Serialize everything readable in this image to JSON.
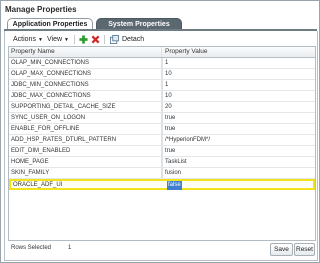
{
  "window": {
    "title": "Manage Properties"
  },
  "tabs": [
    {
      "label": "Application Properties",
      "active": true
    },
    {
      "label": "System Properties",
      "active": false
    }
  ],
  "toolbar": {
    "actions_label": "Actions",
    "view_label": "View",
    "detach_label": "Detach",
    "icons": [
      "add-icon",
      "delete-icon",
      "detach-icon"
    ]
  },
  "table": {
    "columns": [
      "Property Name",
      "Property Value"
    ],
    "rows": [
      {
        "name": "OLAP_MIN_CONNECTIONS",
        "value": "1"
      },
      {
        "name": "OLAP_MAX_CONNECTIONS",
        "value": "10"
      },
      {
        "name": "JDBC_MIN_CONNECTIONS",
        "value": "1"
      },
      {
        "name": "JDBC_MAX_CONNECTIONS",
        "value": "10"
      },
      {
        "name": "SUPPORTING_DETAIL_CACHE_SIZE",
        "value": "20"
      },
      {
        "name": "SYNC_USER_ON_LOGON",
        "value": "true"
      },
      {
        "name": "ENABLE_FOR_OFFLINE",
        "value": "true"
      },
      {
        "name": "ADD_HSP_RATES_DTURL_PATTERN",
        "value": "/*HyperionFDM*/"
      },
      {
        "name": "EDIT_DIM_ENABLED",
        "value": "true"
      },
      {
        "name": "HOME_PAGE",
        "value": "TaskList"
      },
      {
        "name": "SKIN_FAMILY",
        "value": "fusion"
      },
      {
        "name": "ORACLE_ADF_UI",
        "value": "false",
        "selected": true
      }
    ]
  },
  "footer": {
    "rows_selected_label": "Rows Selected",
    "rows_selected_count": "1",
    "save_label": "Save",
    "reset_label": "Reset"
  },
  "colors": {
    "selection_border": "#f2e21b",
    "edit_highlight": "#3e7fd1",
    "inactive_tab": "#5b6870",
    "add_icon": "#2e9b2e",
    "delete_icon": "#d22b2b"
  }
}
